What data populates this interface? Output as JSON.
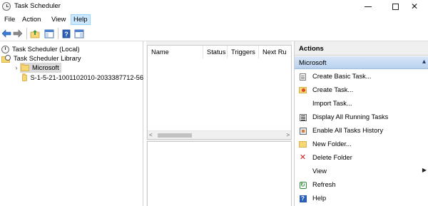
{
  "window": {
    "title": "Task Scheduler",
    "minimize_glyph": "",
    "maximize_glyph": "",
    "close_glyph": "✕"
  },
  "menu": {
    "file": "File",
    "action": "Action",
    "view": "View",
    "help": "Help"
  },
  "tree": {
    "root": "Task Scheduler (Local)",
    "library": "Task Scheduler Library",
    "microsoft": "Microsoft",
    "sid_folder": "S-1-5-21-1001102010-2033387712-56"
  },
  "task_list": {
    "columns": [
      "Name",
      "Status",
      "Triggers",
      "Next Ru"
    ]
  },
  "actions": {
    "header": "Actions",
    "group": "Microsoft",
    "items": [
      {
        "label": "Create Basic Task...",
        "icon": "task-icon"
      },
      {
        "label": "Create Task...",
        "icon": "clock-folder-icon"
      },
      {
        "label": "Import Task...",
        "icon": "none"
      },
      {
        "label": "Display All Running Tasks",
        "icon": "list-icon"
      },
      {
        "label": "Enable All Tasks History",
        "icon": "history-icon"
      },
      {
        "label": "New Folder...",
        "icon": "folder-icon"
      },
      {
        "label": "Delete Folder",
        "icon": "delete-icon"
      },
      {
        "label": "View",
        "icon": "none"
      },
      {
        "label": "Refresh",
        "icon": "refresh-icon"
      },
      {
        "label": "Help",
        "icon": "help-icon"
      }
    ]
  },
  "colors": {
    "selection": "#d9d9d9",
    "group_header": "#b9d1ee",
    "menu_hover": "#cce8ff"
  }
}
